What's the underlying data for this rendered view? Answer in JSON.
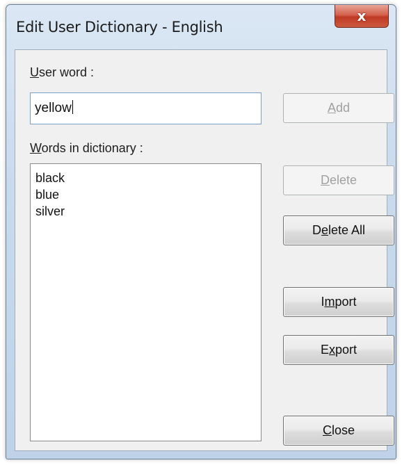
{
  "window": {
    "title": "Edit User Dictionary - English",
    "close_glyph": "x"
  },
  "user_word": {
    "label_accel": "U",
    "label_rest": "ser word :",
    "value": "yellow"
  },
  "dictionary": {
    "label_accel": "W",
    "label_rest": "ords in dictionary :",
    "words": [
      "black",
      "blue",
      "silver"
    ]
  },
  "buttons": {
    "add": {
      "pre": "",
      "accel": "A",
      "post": "dd",
      "enabled": false
    },
    "delete": {
      "pre": "",
      "accel": "D",
      "post": "elete",
      "enabled": false
    },
    "delete_all": {
      "pre": "D",
      "accel": "e",
      "post": "lete All",
      "enabled": true
    },
    "import": {
      "pre": "I",
      "accel": "m",
      "post": "port",
      "enabled": true
    },
    "export": {
      "pre": "E",
      "accel": "x",
      "post": "port",
      "enabled": true
    },
    "close": {
      "pre": "",
      "accel": "C",
      "post": "lose",
      "enabled": true
    }
  }
}
